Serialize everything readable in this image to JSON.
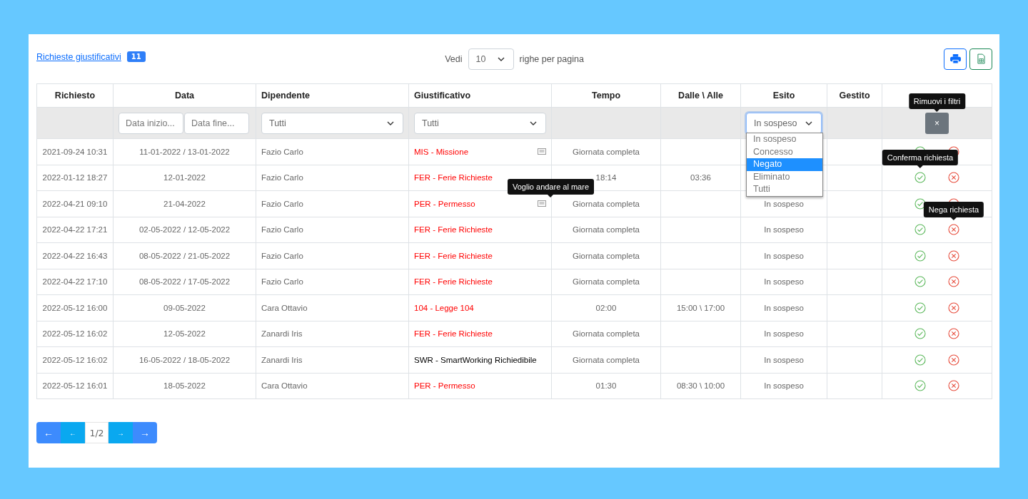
{
  "header": {
    "title": "Richieste giustificativi",
    "count": "11",
    "show_label": "Vedi",
    "page_size": "10",
    "per_page_label": "righe per pagina"
  },
  "columns": [
    "Richiesto",
    "Data",
    "Dipendente",
    "Giustificativo",
    "Tempo",
    "Dalle \\ Alle",
    "Esito",
    "Gestito"
  ],
  "filters": {
    "date_from_placeholder": "Data inizio...",
    "date_to_placeholder": "Data fine...",
    "employee": "Tutti",
    "justification": "Tutti",
    "outcome": "In sospeso",
    "outcome_options": [
      {
        "label": "In sospeso",
        "selected": false
      },
      {
        "label": "Concesso",
        "selected": false
      },
      {
        "label": "Negato",
        "selected": true
      },
      {
        "label": "Eliminato",
        "selected": false
      },
      {
        "label": "Tutti",
        "selected": false
      }
    ],
    "clear_tooltip": "Rimuovi i filtri",
    "clear_button": "×"
  },
  "rows": [
    {
      "requested": "2021-09-24 10:31",
      "date": "11-01-2022 / 13-01-2022",
      "employee": "Fazio Carlo",
      "justification": "MIS - Missione",
      "color": "#ff0000",
      "has_note": true,
      "time": "Giornata completa",
      "range": ""
    },
    {
      "requested": "2022-01-12 18:27",
      "date": "12-01-2022",
      "employee": "Fazio Carlo",
      "justification": "FER - Ferie Richieste",
      "color": "#ff0000",
      "has_note": false,
      "time": "18:14",
      "range": "03:36",
      "confirm_tooltip": "Conferma richiesta"
    },
    {
      "requested": "2022-04-21 09:10",
      "date": "21-04-2022",
      "employee": "Fazio Carlo",
      "justification": "PER - Permesso",
      "color": "#ff0000",
      "has_note": true,
      "note_tooltip": "Voglio andare al mare",
      "time": "Giornata completa",
      "range": "",
      "outcome": "In sospeso"
    },
    {
      "requested": "2022-04-22 17:21",
      "date": "02-05-2022 / 12-05-2022",
      "employee": "Fazio Carlo",
      "justification": "FER - Ferie Richieste",
      "color": "#ff0000",
      "has_note": false,
      "time": "Giornata completa",
      "range": "",
      "outcome": "In sospeso",
      "deny_tooltip": "Nega richiesta"
    },
    {
      "requested": "2022-04-22 16:43",
      "date": "08-05-2022 / 21-05-2022",
      "employee": "Fazio Carlo",
      "justification": "FER - Ferie Richieste",
      "color": "#ff0000",
      "has_note": false,
      "time": "Giornata completa",
      "range": "",
      "outcome": "In sospeso"
    },
    {
      "requested": "2022-04-22 17:10",
      "date": "08-05-2022 / 17-05-2022",
      "employee": "Fazio Carlo",
      "justification": "FER - Ferie Richieste",
      "color": "#ff0000",
      "has_note": false,
      "time": "Giornata completa",
      "range": "",
      "outcome": "In sospeso"
    },
    {
      "requested": "2022-05-12 16:00",
      "date": "09-05-2022",
      "employee": "Cara Ottavio",
      "justification": "104 - Legge 104",
      "color": "#ff0000",
      "has_note": false,
      "time": "02:00",
      "range": "15:00 \\ 17:00",
      "outcome": "In sospeso"
    },
    {
      "requested": "2022-05-12 16:02",
      "date": "12-05-2022",
      "employee": "Zanardi Iris",
      "justification": "FER - Ferie Richieste",
      "color": "#ff0000",
      "has_note": false,
      "time": "Giornata completa",
      "range": "",
      "outcome": "In sospeso"
    },
    {
      "requested": "2022-05-12 16:02",
      "date": "16-05-2022 / 18-05-2022",
      "employee": "Zanardi Iris",
      "justification": "SWR - SmartWorking Richiedibile",
      "color": "#000000",
      "has_note": false,
      "time": "Giornata completa",
      "range": "",
      "outcome": "In sospeso"
    },
    {
      "requested": "2022-05-12 16:01",
      "date": "18-05-2022",
      "employee": "Cara Ottavio",
      "justification": "PER - Permesso",
      "color": "#ff0000",
      "has_note": false,
      "time": "01:30",
      "range": "08:30 \\ 10:00",
      "outcome": "In sospeso"
    }
  ],
  "pagination": [
    {
      "label": "←",
      "kind": "end"
    },
    {
      "label": "←",
      "kind": "step"
    },
    {
      "label": "1/2",
      "kind": "page"
    },
    {
      "label": "→",
      "kind": "step"
    },
    {
      "label": "→",
      "kind": "end"
    }
  ]
}
